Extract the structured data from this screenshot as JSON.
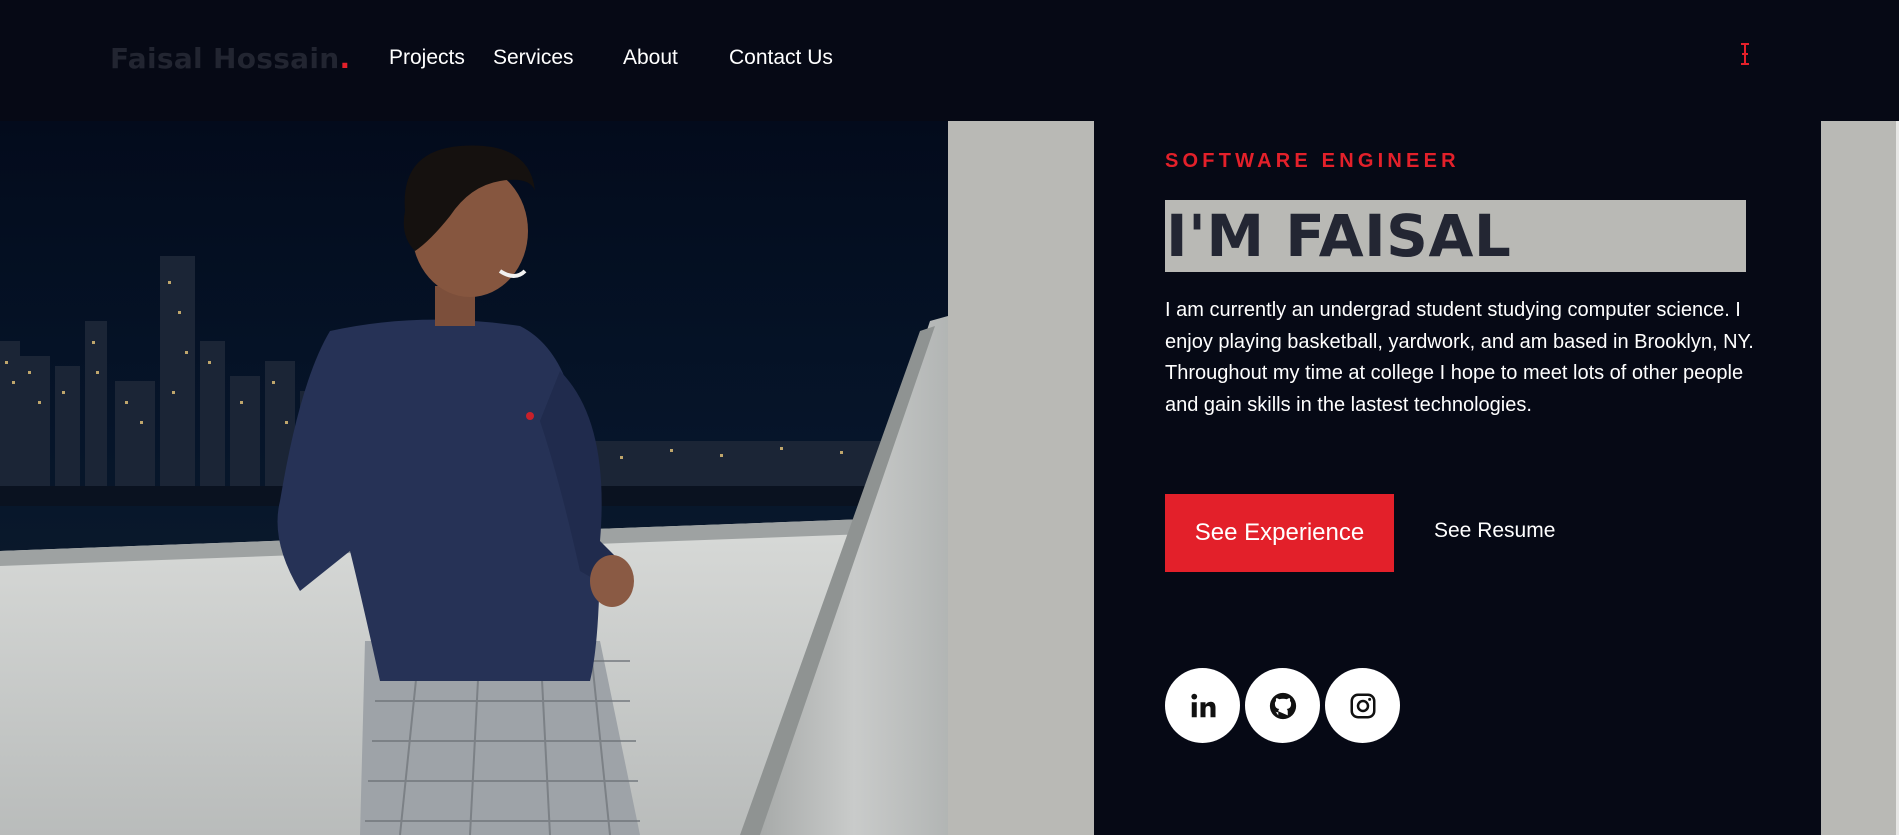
{
  "header": {
    "logo_name": "Faisal Hossain",
    "logo_dot": ".",
    "nav": [
      {
        "label": "Projects"
      },
      {
        "label": "Services"
      },
      {
        "label": "About"
      },
      {
        "label": "Contact Us"
      }
    ]
  },
  "hero": {
    "eyebrow": "SOFTWARE ENGINEER",
    "headline": "I'M FAISAL",
    "bio": "I am currently an undergrad student studying computer science. I enjoy playing basketball, yardwork, and am based in Brooklyn, NY. Throughout my time at college I hope to meet lots of other people and gain skills in the lastest technologies.",
    "primary_button": "See Experience",
    "secondary_link": "See Resume"
  },
  "social": [
    {
      "icon": "linkedin-icon"
    },
    {
      "icon": "github-icon"
    },
    {
      "icon": "instagram-icon"
    }
  ],
  "colors": {
    "background": "#060915",
    "accent": "#e3202a",
    "panel": "#b9b9b5",
    "headline_text": "#232633"
  }
}
